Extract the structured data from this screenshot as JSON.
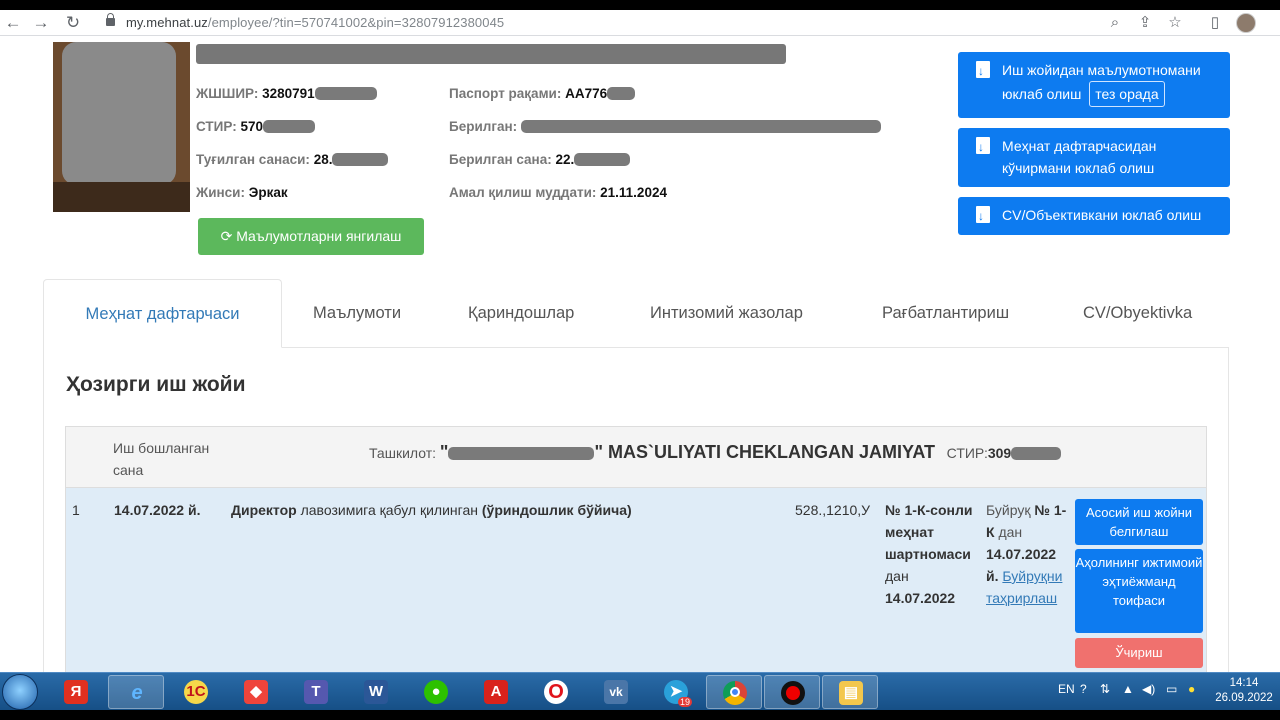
{
  "browser": {
    "url_host": "my.mehnat.uz",
    "url_path": "/employee/?tin=570741002&pin=32807912380045"
  },
  "profile": {
    "pinfl_label": "ЖШШИР:",
    "pinfl_value": "3280791",
    "stir_label": "СТИР:",
    "stir_value": "570",
    "birth_label": "Туғилган санаси:",
    "birth_value": "28.",
    "gender_label": "Жинси:",
    "gender_value": "Эркак",
    "passport_label": "Паспорт рақами:",
    "passport_value": "AA776",
    "issued_by_label": "Берилган:",
    "issued_date_label": "Берилган сана:",
    "issued_date_value": "22.",
    "valid_label": "Амал қилиш муддати:",
    "valid_value": "21.11.2024",
    "refresh_button": "Маълумотларни янгилаш"
  },
  "actions": {
    "download_workplace": "Иш жойидан маълумотномани юклаб олиш",
    "soon_badge": "тез орада",
    "download_workbook": "Меҳнат дафтарчасидан кўчирмани юклаб олиш",
    "download_cv": "CV/Объективкани юклаб олиш"
  },
  "tabs": [
    "Меҳнат дафтарчаси",
    "Маълумоти",
    "Қариндошлар",
    "Интизомий жазолар",
    "Рағбатлантириш",
    "CV/Obyektivka"
  ],
  "section": {
    "title": "Ҳозирги иш жойи",
    "col_start": "Иш бошланган сана",
    "org_label": "Ташкилот:",
    "org_quote_open": "\"",
    "org_name": "\" MAS`ULIYATI CHEKLANGAN JAMIYAT",
    "stir_label": "СТИР:",
    "stir_value": "309"
  },
  "row": {
    "num": "1",
    "date": "14.07.2022 й.",
    "position_bold": "Директор",
    "position_text": "лавозимига қабул қилинган",
    "position_note": "(ўриндошлик бўйича)",
    "code": "528.,1210,У",
    "contract_bold": "№ 1-К-сонли меҳнат шартномаси",
    "contract_from": "дан",
    "contract_date": "14.07.2022",
    "order_label": "Буйруқ",
    "order_no": "№ 1-К",
    "order_from": "дан",
    "order_date": "14.07.2022 й.",
    "order_edit": "Буйруқни таҳрирлаш",
    "btn_main": "Асосий иш жойни белгилаш",
    "btn_social": "Аҳолининг ижтимоий эҳтиёжманд тоифаси",
    "btn_delete": "Ўчириш"
  },
  "taskbar": {
    "lang": "EN",
    "time": "14:14",
    "date": "26.09.2022",
    "telegram_badge": "19",
    "apps": [
      "yandex-icon",
      "ie-icon",
      "1c-icon",
      "anydesk-icon",
      "teams-icon",
      "word-icon",
      "wechat-icon",
      "acrobat-icon",
      "opera-icon",
      "vk-icon",
      "telegram-icon",
      "chrome-icon",
      "recorder-icon",
      "explorer-icon"
    ]
  }
}
